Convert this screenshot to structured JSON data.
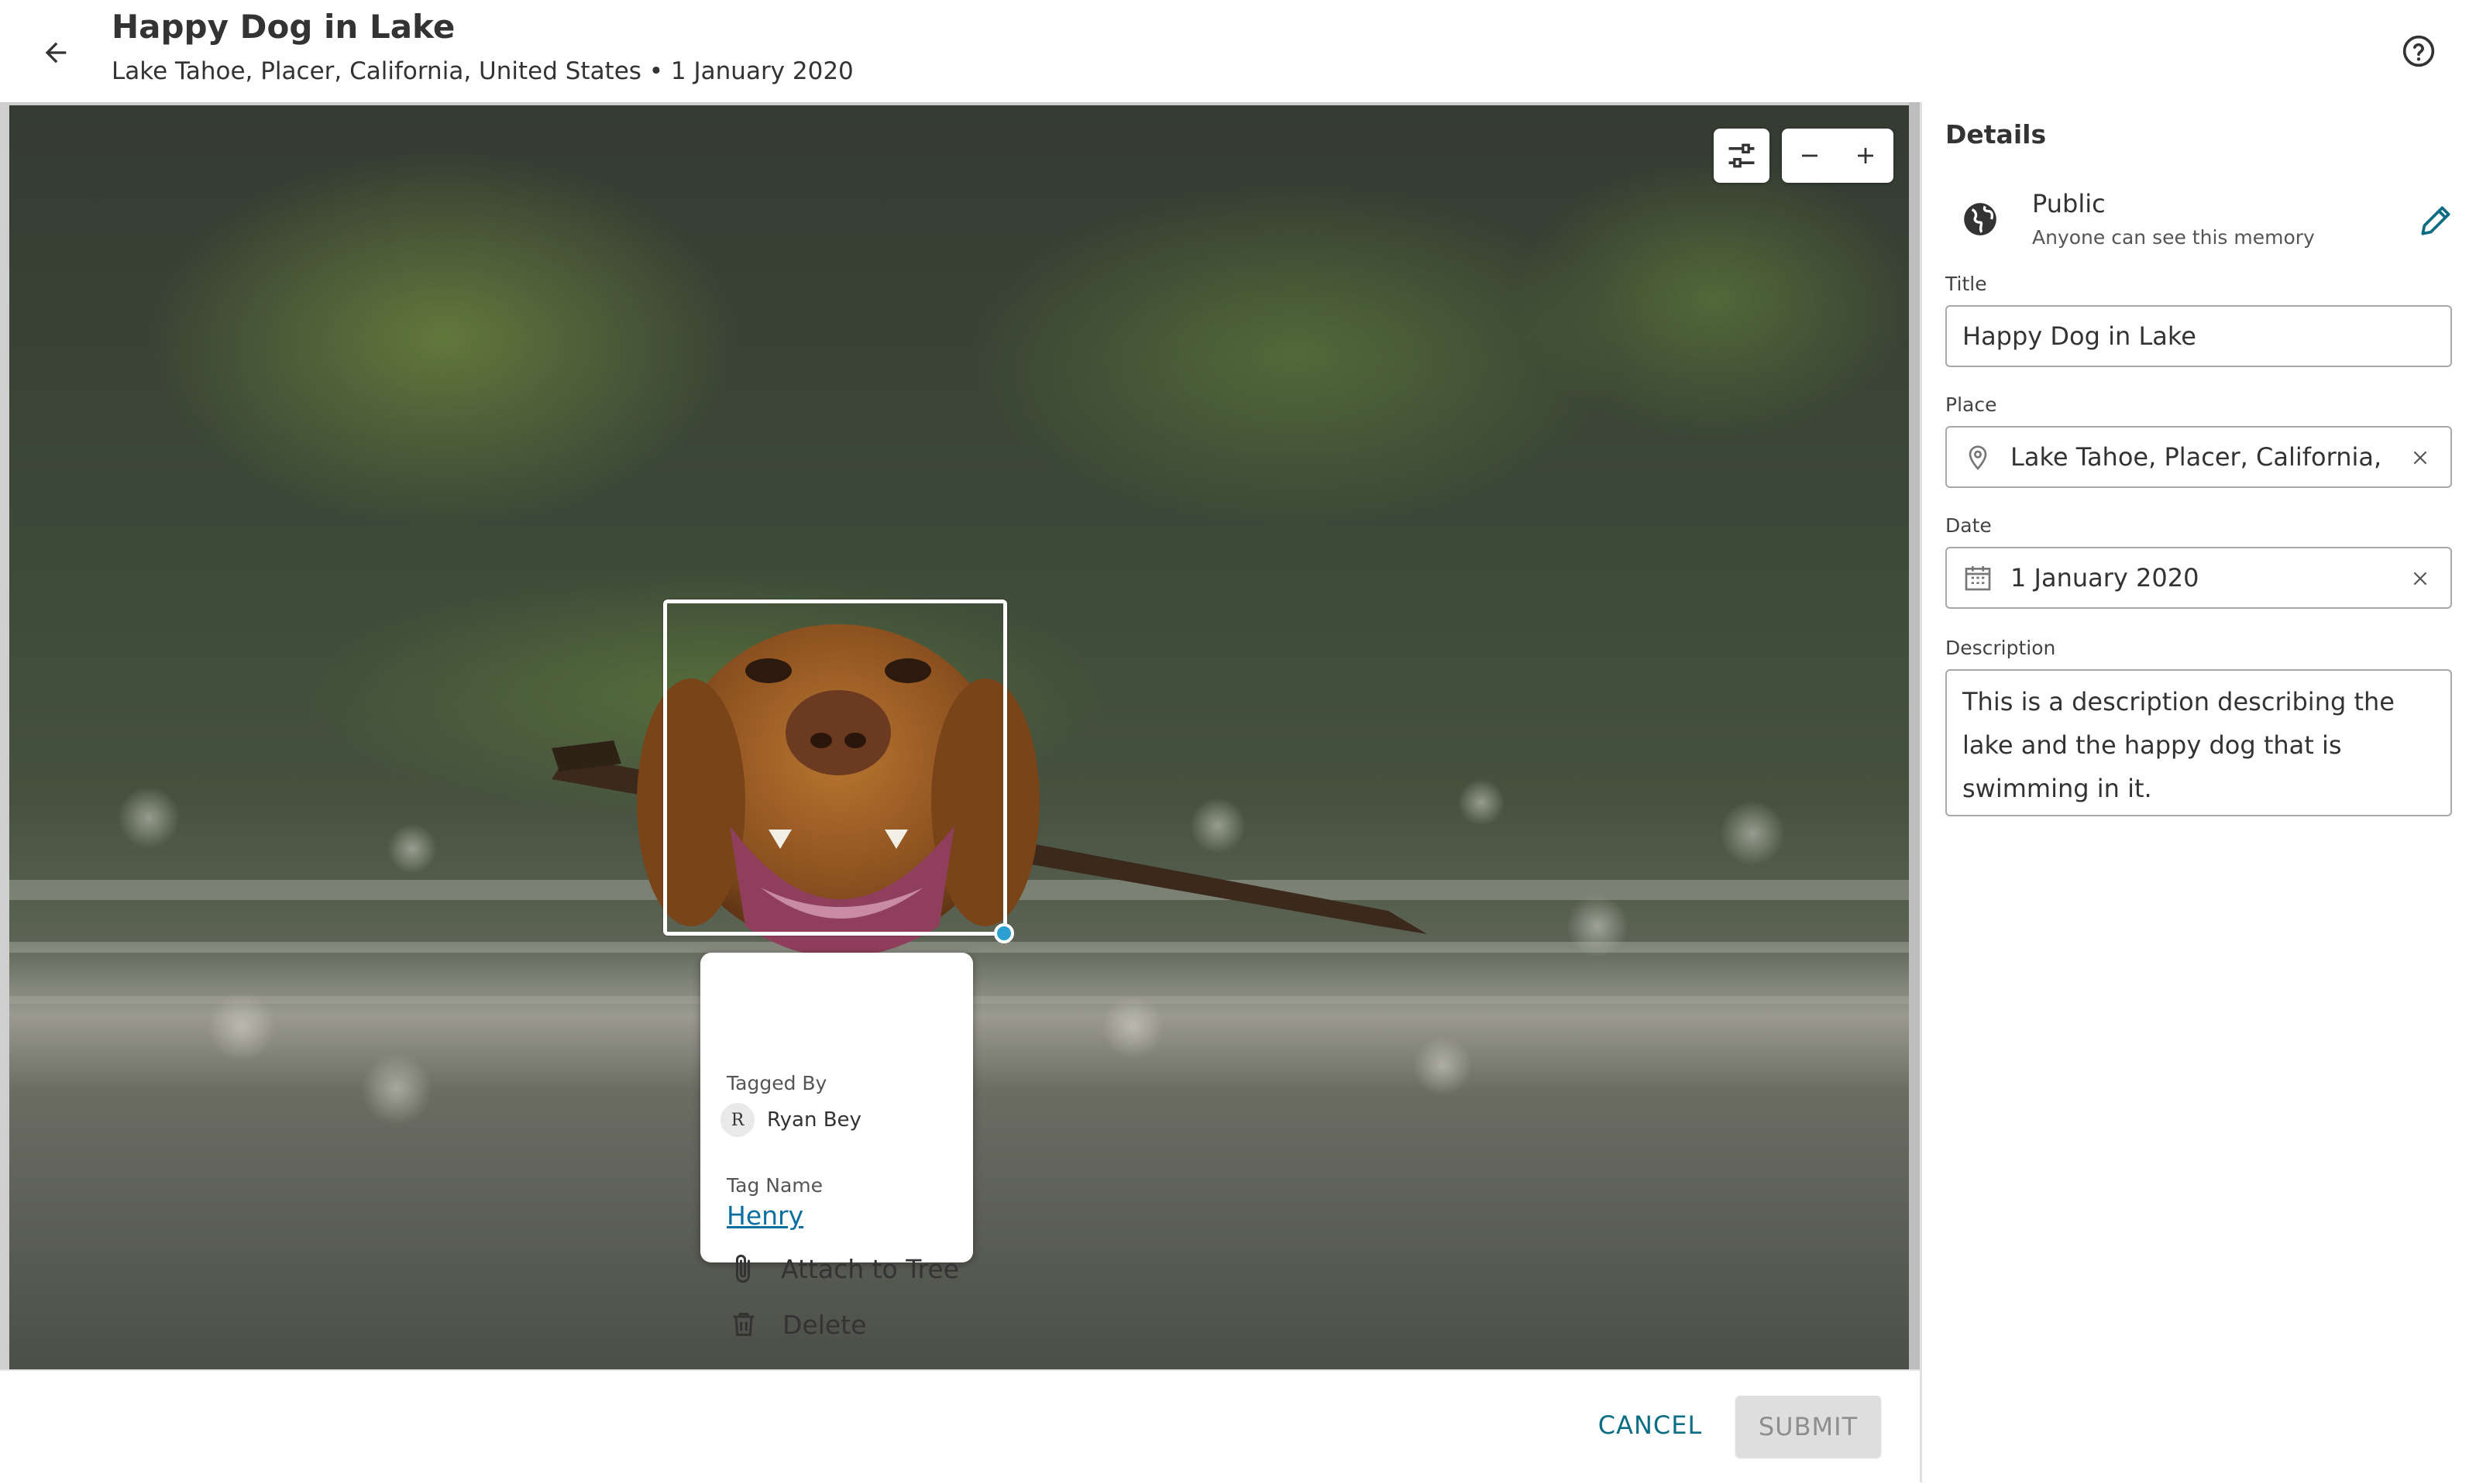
{
  "header": {
    "title": "Happy Dog in Lake",
    "subtitle": "Lake Tahoe, Placer, California, United States • 1 January 2020"
  },
  "viewer": {
    "tag_popup": {
      "tagged_by_label": "Tagged By",
      "tagger_initial": "R",
      "tagger_name": "Ryan Bey",
      "tag_name_label": "Tag Name",
      "tag_name": "Henry",
      "attach_label": "Attach to Tree",
      "delete_label": "Delete"
    }
  },
  "footer": {
    "cancel_label": "CANCEL",
    "submit_label": "SUBMIT"
  },
  "details": {
    "heading": "Details",
    "visibility": {
      "title": "Public",
      "description": "Anyone can see this memory",
      "icon": "globe-icon"
    },
    "title_label": "Title",
    "title_value": "Happy Dog in Lake",
    "place_label": "Place",
    "place_value": "Lake Tahoe, Placer, California, United States",
    "date_label": "Date",
    "date_value": "1 January 2020",
    "description_label": "Description",
    "description_value": "This is a description describing the lake and the happy dog that is swimming in it."
  },
  "colors": {
    "accent": "#0c6d83",
    "link": "#0c6fa0",
    "handle": "#2a9fd0",
    "submit_disabled_bg": "#dedede"
  }
}
